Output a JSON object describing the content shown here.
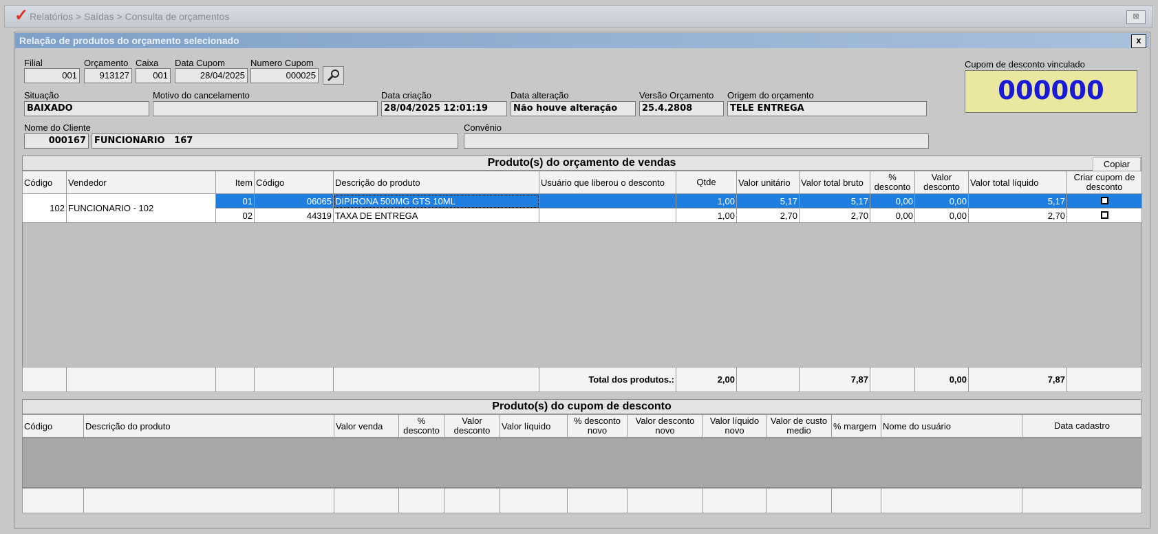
{
  "window": {
    "breadcrumb": "Relatórios > Saídas > Consulta de orçamentos",
    "close_label": "⊠"
  },
  "dialog": {
    "title": "Relação de produtos do orçamento selecionado",
    "close_label": "x"
  },
  "form": {
    "filial": {
      "label": "Filial",
      "value": "001"
    },
    "orcamento": {
      "label": "Orçamento",
      "value": "913127"
    },
    "caixa": {
      "label": "Caixa",
      "value": "001"
    },
    "data_cupom": {
      "label": "Data Cupom",
      "value": "28/04/2025"
    },
    "numero_cupom": {
      "label": "Numero Cupom",
      "value": "000025"
    },
    "situacao": {
      "label": "Situação",
      "value": "BAIXADO"
    },
    "motivo": {
      "label": "Motivo do cancelamento",
      "value": ""
    },
    "data_criacao": {
      "label": "Data criação",
      "value": "28/04/2025 12:01:19"
    },
    "data_alteracao": {
      "label": "Data alteração",
      "value": "Não houve alteração"
    },
    "versao": {
      "label": "Versão Orçamento",
      "value": "25.4.2808"
    },
    "origem": {
      "label": "Origem do orçamento",
      "value": "TELE ENTREGA"
    },
    "cliente": {
      "label": "Nome do Cliente",
      "code": "000167",
      "name": "FUNCIONARIO   167"
    },
    "convenio": {
      "label": "Convênio",
      "value": ""
    },
    "cupom_vinculado": {
      "label": "Cupom de desconto vinculado",
      "value": "000000"
    }
  },
  "products_grid": {
    "title": "Produto(s) do orçamento de vendas",
    "copy_label": "Copiar",
    "headers": [
      "Código",
      "Vendedor",
      "Item",
      "Código",
      "Descrição do produto",
      "Usuário que liberou o  desconto",
      "Qtde",
      "Valor unitário",
      "Valor total bruto",
      "% desconto",
      "Valor desconto",
      "Valor total líquido",
      "Criar cupom de desconto"
    ],
    "seller": {
      "code": "102",
      "name": "FUNCIONARIO - 102"
    },
    "rows": [
      {
        "item": "01",
        "codigo": "06065",
        "descricao": "DIPIRONA 500MG GTS 10ML",
        "usuario": "",
        "qtde": "1,00",
        "unit": "5,17",
        "bruto": "5,17",
        "pct": "0,00",
        "desc": "0,00",
        "liquido": "5,17"
      },
      {
        "item": "02",
        "codigo": "44319",
        "descricao": "TAXA DE ENTREGA",
        "usuario": "",
        "qtde": "1,00",
        "unit": "2,70",
        "bruto": "2,70",
        "pct": "0,00",
        "desc": "0,00",
        "liquido": "2,70"
      }
    ],
    "totals": {
      "label": "Total dos produtos.:",
      "qtde": "2,00",
      "bruto": "7,87",
      "desc": "0,00",
      "liquido": "7,87"
    }
  },
  "coupon_grid": {
    "title": "Produto(s) do cupom de desconto",
    "headers": [
      "Código",
      "Descrição do produto",
      "Valor venda",
      "% desconto",
      "Valor desconto",
      "Valor líquido",
      "% desconto novo",
      "Valor desconto novo",
      "Valor líquido novo",
      "Valor de custo medio",
      "% margem",
      "Nome do usuário",
      "Data cadastro"
    ]
  }
}
